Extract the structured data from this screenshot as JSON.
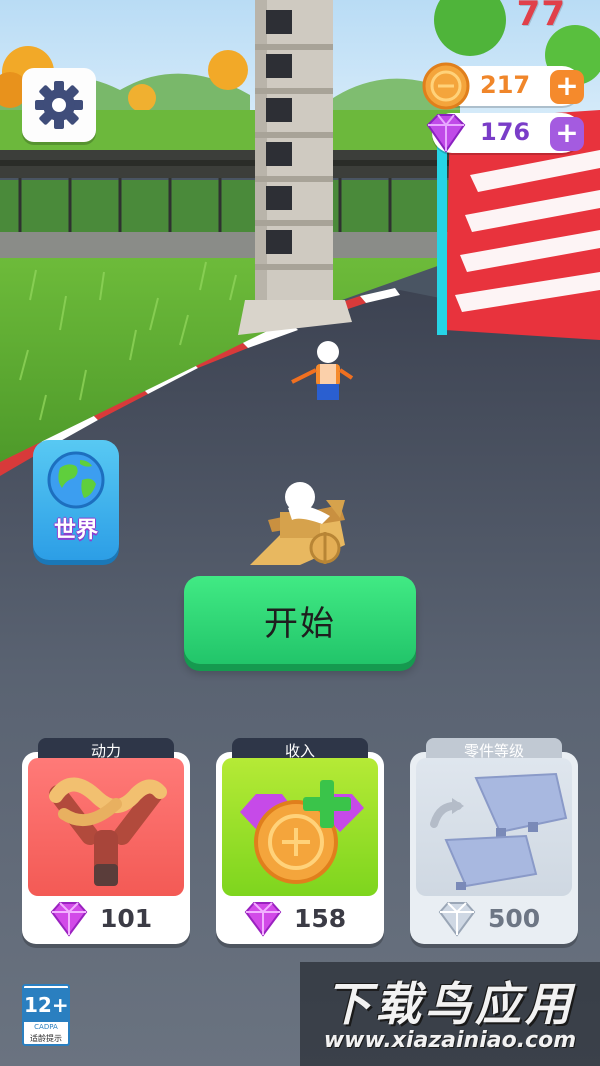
{
  "hud": {
    "score": "77",
    "coins": {
      "value": "217",
      "plus": "+",
      "icon": "coin-icon"
    },
    "gems": {
      "value": "176",
      "plus": "+",
      "icon": "gem-icon"
    }
  },
  "buttons": {
    "settings_icon": "gear-icon",
    "world_label": "世界",
    "world_icon": "globe-icon",
    "start_label": "开始"
  },
  "upgrades": [
    {
      "title": "动力",
      "price": "101",
      "icon": "slingshot-icon",
      "currency": "gem"
    },
    {
      "title": "收入",
      "price": "158",
      "icon": "coin-plus-icon",
      "currency": "gem"
    },
    {
      "title": "零件等级",
      "price": "500",
      "icon": "wing-parts-icon",
      "currency": "diamond"
    }
  ],
  "age_rating": {
    "number": "12+",
    "org": "CADPA",
    "tip": "适龄提示"
  },
  "watermark": {
    "name": "下载鸟应用",
    "url": "www.xiazainiao.com"
  },
  "colors": {
    "start_green": "#2bd574",
    "world_blue": "#3aaeee",
    "coin_orange": "#f58a2c",
    "gem_purple": "#a45be0",
    "score_red": "#e0404a"
  }
}
